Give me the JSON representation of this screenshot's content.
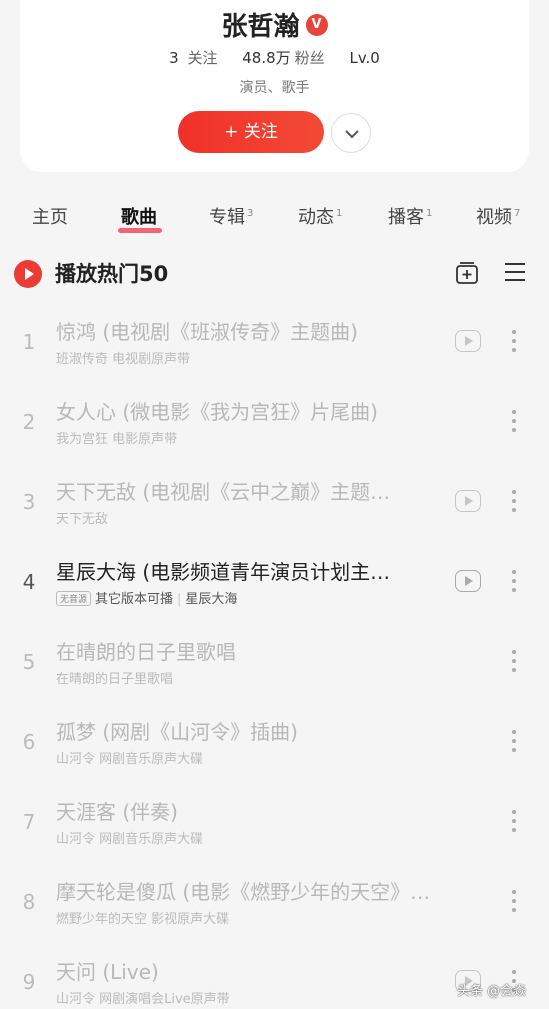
{
  "profile": {
    "name": "张哲瀚",
    "badge": "V",
    "following_count": "3",
    "following_label": "关注",
    "fans_count": "48.8万",
    "fans_label": "粉丝",
    "level": "Lv.0",
    "tags": "演员、歌手",
    "follow_button": "+ 关注"
  },
  "tabs": [
    {
      "label": "主页",
      "count": ""
    },
    {
      "label": "歌曲",
      "count": ""
    },
    {
      "label": "专辑",
      "count": "3"
    },
    {
      "label": "动态",
      "count": "1"
    },
    {
      "label": "播客",
      "count": "1"
    },
    {
      "label": "视频",
      "count": "7"
    }
  ],
  "active_tab": "歌曲",
  "section": {
    "title": "播放热门50"
  },
  "songs": [
    {
      "rank": "1",
      "title": "惊鸿 (电视剧《班淑传奇》主题曲)",
      "subtitle": "班淑传奇 电视剧原声带",
      "has_mv": true,
      "playable": false,
      "badge": ""
    },
    {
      "rank": "2",
      "title": "女人心 (微电影《我为宫狂》片尾曲)",
      "subtitle": "我为宫狂 电影原声带",
      "has_mv": false,
      "playable": false,
      "badge": ""
    },
    {
      "rank": "3",
      "title": "天下无敌 (电视剧《云中之巅》主题…",
      "subtitle": "天下无敌",
      "has_mv": true,
      "playable": false,
      "badge": ""
    },
    {
      "rank": "4",
      "title": "星辰大海 (电影频道青年演员计划主…",
      "subtitle": "其它版本可播",
      "subtitle2": "星辰大海",
      "has_mv": true,
      "playable": true,
      "badge": "无音源"
    },
    {
      "rank": "5",
      "title": "在晴朗的日子里歌唱",
      "subtitle": "在晴朗的日子里歌唱",
      "has_mv": false,
      "playable": false,
      "badge": ""
    },
    {
      "rank": "6",
      "title": "孤梦 (网剧《山河令》插曲)",
      "subtitle": "山河令 网剧音乐原声大碟",
      "has_mv": false,
      "playable": false,
      "badge": ""
    },
    {
      "rank": "7",
      "title": "天涯客 (伴奏)",
      "subtitle": "山河令 网剧音乐原声大碟",
      "has_mv": false,
      "playable": false,
      "badge": ""
    },
    {
      "rank": "8",
      "title": "摩天轮是傻瓜 (电影《燃野少年的天空》…",
      "subtitle": "燃野少年的天空 影视原声大碟",
      "has_mv": false,
      "playable": false,
      "badge": ""
    },
    {
      "rank": "9",
      "title": "天问 (Live)",
      "subtitle": "山河令 网剧演唱会Live原声带",
      "has_mv": true,
      "playable": false,
      "badge": ""
    }
  ],
  "watermark": "头条 @会焱"
}
